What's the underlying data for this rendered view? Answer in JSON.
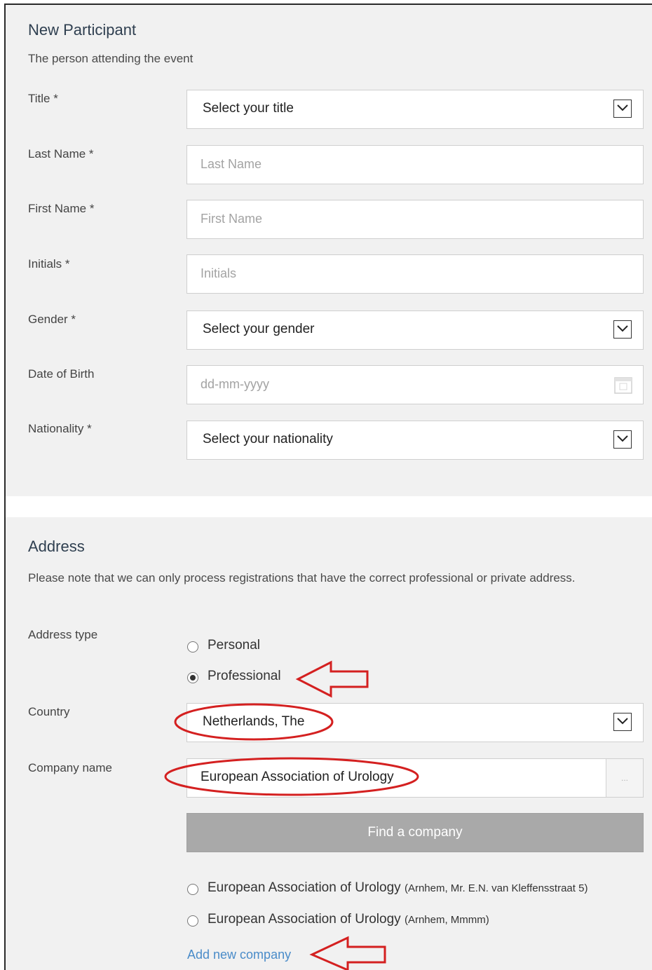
{
  "participant": {
    "heading": "New Participant",
    "subheading": "The person attending the event",
    "fields": [
      {
        "label": "Title *",
        "type": "select",
        "value": "Select your title"
      },
      {
        "label": "Last Name *",
        "type": "text",
        "placeholder": "Last Name"
      },
      {
        "label": "First Name *",
        "type": "text",
        "placeholder": "First Name"
      },
      {
        "label": "Initials *",
        "type": "text",
        "placeholder": "Initials"
      },
      {
        "label": "Gender *",
        "type": "select",
        "value": "Select your gender"
      },
      {
        "label": "Date of Birth",
        "type": "date",
        "placeholder": "dd-mm-yyyy"
      },
      {
        "label": "Nationality *",
        "type": "select",
        "value": "Select your nationality"
      }
    ]
  },
  "address": {
    "heading": "Address",
    "note": "Please note that we can only process registrations that have the correct professional or private address.",
    "address_type_label": "Address type",
    "options": [
      {
        "label": "Personal",
        "selected": false
      },
      {
        "label": "Professional",
        "selected": true
      }
    ],
    "country_label": "Country",
    "country_value": "Netherlands, The",
    "company_label": "Company name",
    "company_value": "European Association of Urology",
    "lookup_button": "...",
    "find_button": "Find a company",
    "results": [
      {
        "name": "European Association of Urology",
        "detail": "(Arnhem, Mr. E.N. van Kleffensstraat 5)",
        "selected": false
      },
      {
        "name": "European Association of Urology",
        "detail": "(Arnhem, Mmmm)",
        "selected": false
      }
    ],
    "add_link": "Add new company"
  },
  "colors": {
    "panel_bg": "#f1f1f1",
    "heading": "#2f3f50",
    "button_bg": "#a9a9a9",
    "link": "#4a8cc9",
    "annotation": "#d42020"
  },
  "icons": {
    "select_arrow": "chevron-down-icon",
    "date": "calendar-icon",
    "annotation_arrow": "red-arrow-icon",
    "annotation_circle": "red-ellipse"
  }
}
